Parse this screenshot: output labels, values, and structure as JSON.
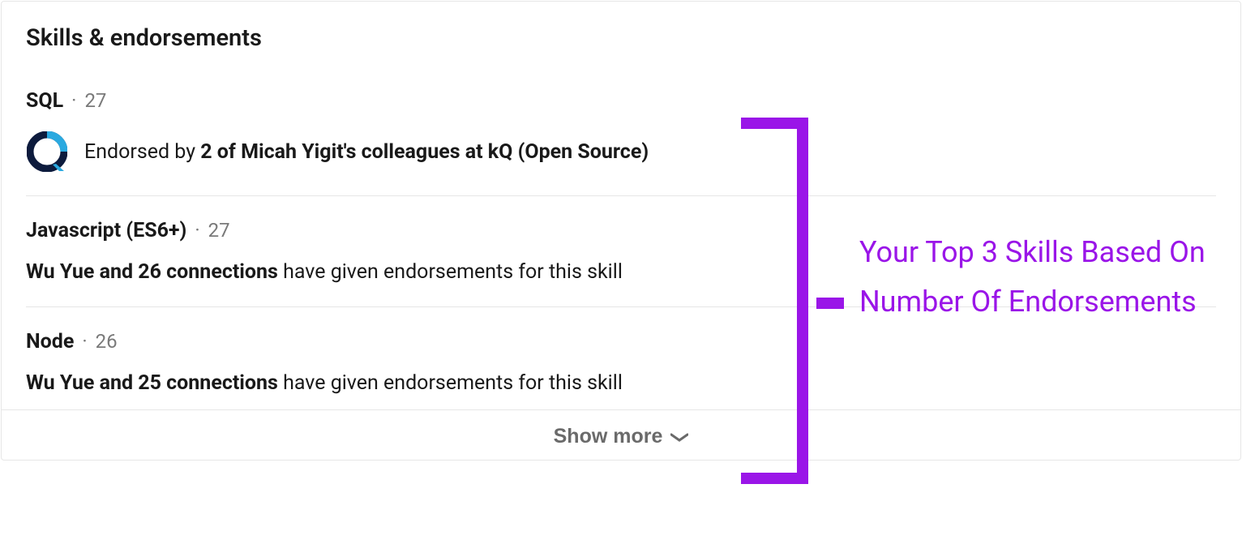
{
  "section": {
    "title": "Skills & endorsements"
  },
  "skills": [
    {
      "name": "SQL",
      "count": "27",
      "endorsement_prefix": "Endorsed by",
      "endorsement_bold": "2 of Micah Yigit's colleagues at kQ (Open Source)",
      "endorsement_suffix": "",
      "has_icon": true
    },
    {
      "name": "Javascript (ES6+)",
      "count": "27",
      "endorsement_prefix": "",
      "endorsement_bold": "Wu Yue and 26 connections",
      "endorsement_suffix": " have given endorsements for this skill",
      "has_icon": false
    },
    {
      "name": "Node",
      "count": "26",
      "endorsement_prefix": "",
      "endorsement_bold": "Wu Yue and 25 connections",
      "endorsement_suffix": " have given endorsements for this skill",
      "has_icon": false
    }
  ],
  "show_more": {
    "label": "Show more"
  },
  "annotation": {
    "text": "Your Top 3 Skills Based On Number Of Endorsements",
    "color": "#9a15e8"
  }
}
